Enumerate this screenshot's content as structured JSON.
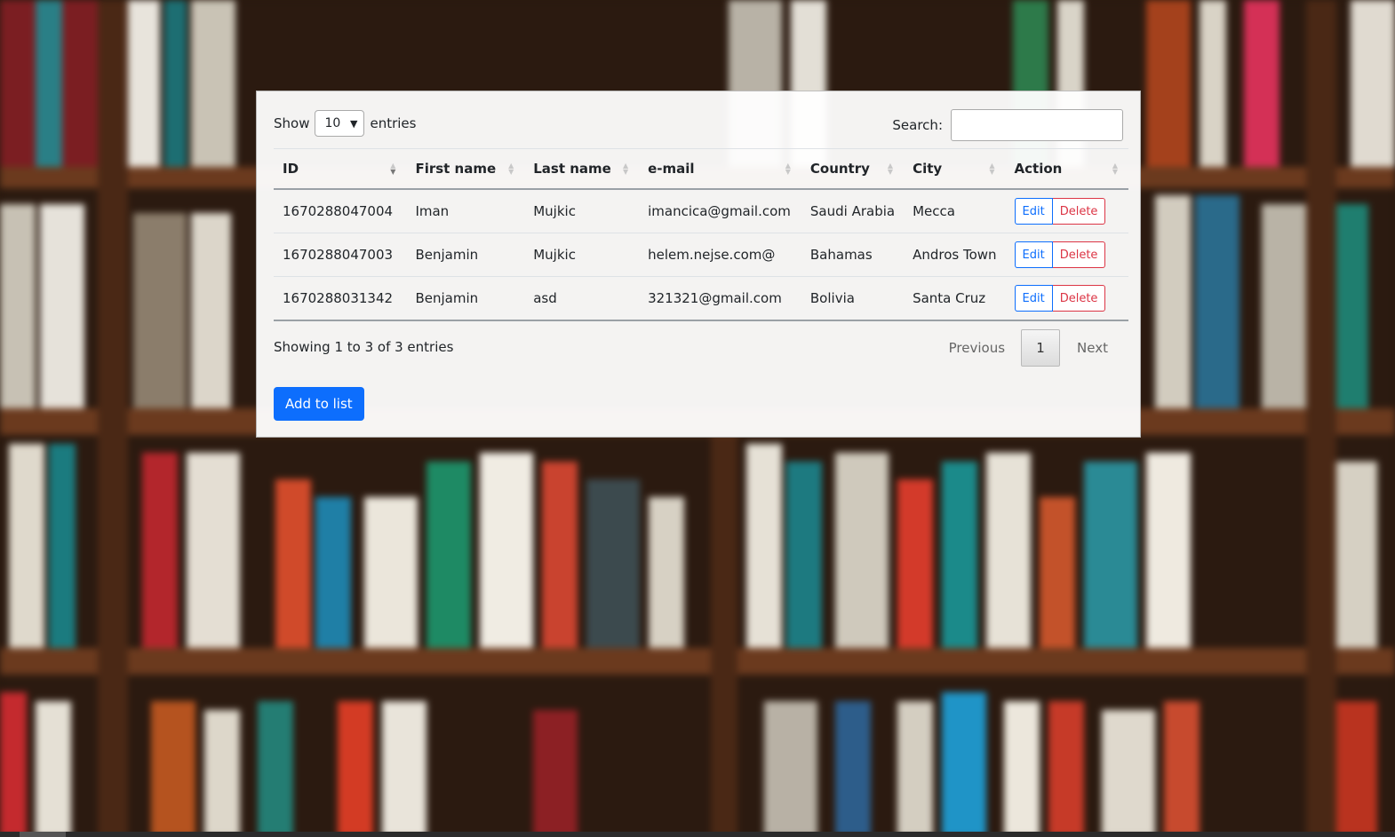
{
  "length_menu": {
    "prefix": "Show",
    "value": "10",
    "suffix": "entries"
  },
  "search": {
    "label": "Search:",
    "value": ""
  },
  "table": {
    "columns": [
      "ID",
      "First name",
      "Last name",
      "e-mail",
      "Country",
      "City",
      "Action"
    ],
    "rows": [
      {
        "id": "1670288047004",
        "first": "Iman",
        "last": "Mujkic",
        "email": "imancica@gmail.com",
        "country": "Saudi Arabia",
        "city": "Mecca"
      },
      {
        "id": "1670288047003",
        "first": "Benjamin",
        "last": "Mujkic",
        "email": "helem.nejse.com@",
        "country": "Bahamas",
        "city": "Andros Town"
      },
      {
        "id": "1670288031342",
        "first": "Benjamin",
        "last": "asd",
        "email": "321321@gmail.com",
        "country": "Bolivia",
        "city": "Santa Cruz"
      }
    ],
    "edit_label": "Edit",
    "delete_label": "Delete"
  },
  "info": "Showing 1 to 3 of 3 entries",
  "pagination": {
    "previous": "Previous",
    "current": "1",
    "next": "Next"
  },
  "add_button": "Add to list",
  "colors": {
    "primary": "#0d6efd",
    "danger": "#dc3545"
  }
}
